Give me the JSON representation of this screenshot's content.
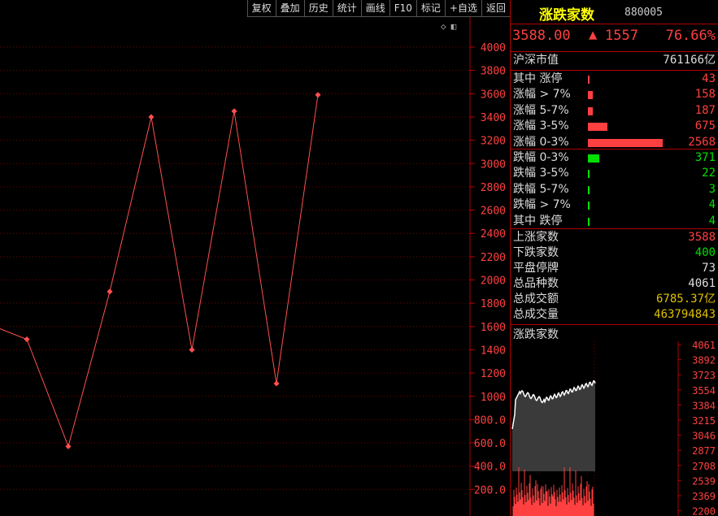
{
  "toolbar": [
    "复权",
    "叠加",
    "历史",
    "统计",
    "画线",
    "F10",
    "标记",
    "+自选",
    "返回"
  ],
  "chart_tools": {
    "diamond": "◇",
    "window": "◧"
  },
  "chart_data": {
    "type": "line",
    "y_ticks": [
      "4000",
      "3800",
      "3600",
      "3400",
      "3200",
      "3000",
      "2800",
      "2600",
      "2400",
      "2200",
      "2000",
      "1800",
      "1600",
      "1400",
      "1200",
      "1000",
      "800.0",
      "600.0",
      "400.0",
      "200.0"
    ],
    "ylim": [
      0,
      4100
    ],
    "series": [
      {
        "values": [
          1630,
          1490,
          570,
          1900,
          3400,
          1400,
          3450,
          1110,
          3590
        ]
      }
    ]
  },
  "side": {
    "title": "涨跌家数",
    "code": "880005",
    "price": "3588.00",
    "arrow": "▲",
    "change": "1557",
    "pct": "76.66%",
    "market_cap_label": "沪深市值",
    "market_cap_value": "761166亿",
    "rows_up": [
      {
        "label": "其中 涨停",
        "value": "43",
        "level": 0.02
      },
      {
        "label": "涨幅 > 7%",
        "value": "158",
        "level": 0.06
      },
      {
        "label": "涨幅 5-7%",
        "value": "187",
        "level": 0.07
      },
      {
        "label": "涨幅 3-5%",
        "value": "675",
        "level": 0.26
      },
      {
        "label": "涨幅 0-3%",
        "value": "2568",
        "level": 1.0
      }
    ],
    "rows_down": [
      {
        "label": "跌幅 0-3%",
        "value": "371",
        "level": 0.15
      },
      {
        "label": "跌幅 3-5%",
        "value": "22",
        "level": 0.01
      },
      {
        "label": "跌幅 5-7%",
        "value": "3",
        "level": 0.005
      },
      {
        "label": "跌幅 > 7%",
        "value": "4",
        "level": 0.005
      },
      {
        "label": "其中 跌停",
        "value": "4",
        "level": 0.005
      }
    ],
    "stats": [
      {
        "label": "上涨家数",
        "value": "3588",
        "color": "red"
      },
      {
        "label": "下跌家数",
        "value": "400",
        "color": "green"
      },
      {
        "label": "平盘停牌",
        "value": "73",
        "color": "white"
      },
      {
        "label": "总品种数",
        "value": "4061",
        "color": "white"
      },
      {
        "label": "总成交额",
        "value": "6785.37亿",
        "color": "yellow"
      },
      {
        "label": "总成交量",
        "value": "463794843",
        "color": "yellow"
      }
    ],
    "mini_title": "涨跌家数",
    "mini_ticks": [
      "4061",
      "3892",
      "3723",
      "3554",
      "3384",
      "3215",
      "3046",
      "2877",
      "2708",
      "2539",
      "2369",
      "2200"
    ]
  }
}
